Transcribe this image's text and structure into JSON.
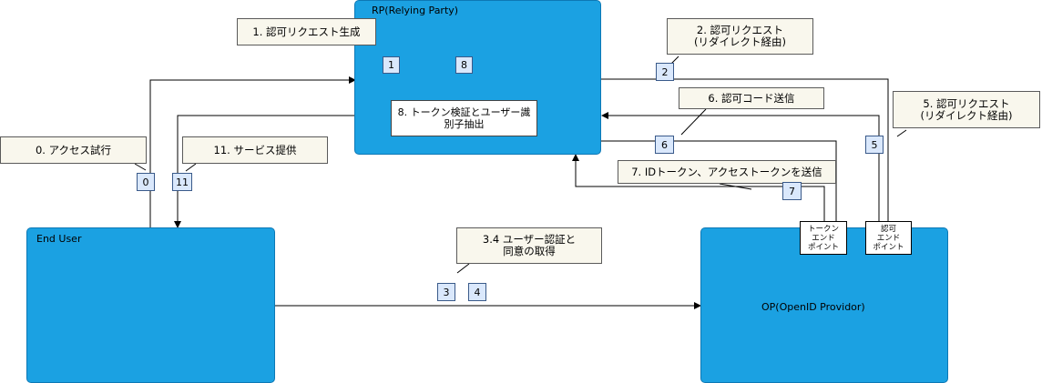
{
  "rp": {
    "title": "RP(Relying Party)"
  },
  "end_user": {
    "title": "End User"
  },
  "op": {
    "title": "OP(OpenID Providor)"
  },
  "rp_inner": {
    "label": "8. トークン検証とユーザー識\n別子抽出"
  },
  "endpoints": {
    "token": "トークン\nエンド\nポイント",
    "auth": "認可\nエンド\nポイント"
  },
  "callouts": {
    "c1": "1. 認可リクエスト生成",
    "c2": "2. 認可リクエスト\n(リダイレクト経由)",
    "c5": "5. 認可リクエスト\n(リダイレクト経由)",
    "c6": "6. 認可コード送信",
    "c7": "7. IDトークン、アクセストークンを送信",
    "c0": "0. アクセス試行",
    "c11": "11. サービス提供",
    "c34": "3.4 ユーザー認証と\n同意の取得"
  },
  "steps": {
    "s0": "0",
    "s1": "1",
    "s2": "2",
    "s3": "3",
    "s4": "4",
    "s5": "5",
    "s6": "6",
    "s7": "7",
    "s8": "8",
    "s11": "11"
  },
  "colors": {
    "box_fill": "#1ba1e2",
    "callout_fill": "#f9f7ed",
    "step_fill": "#dae8fc"
  }
}
